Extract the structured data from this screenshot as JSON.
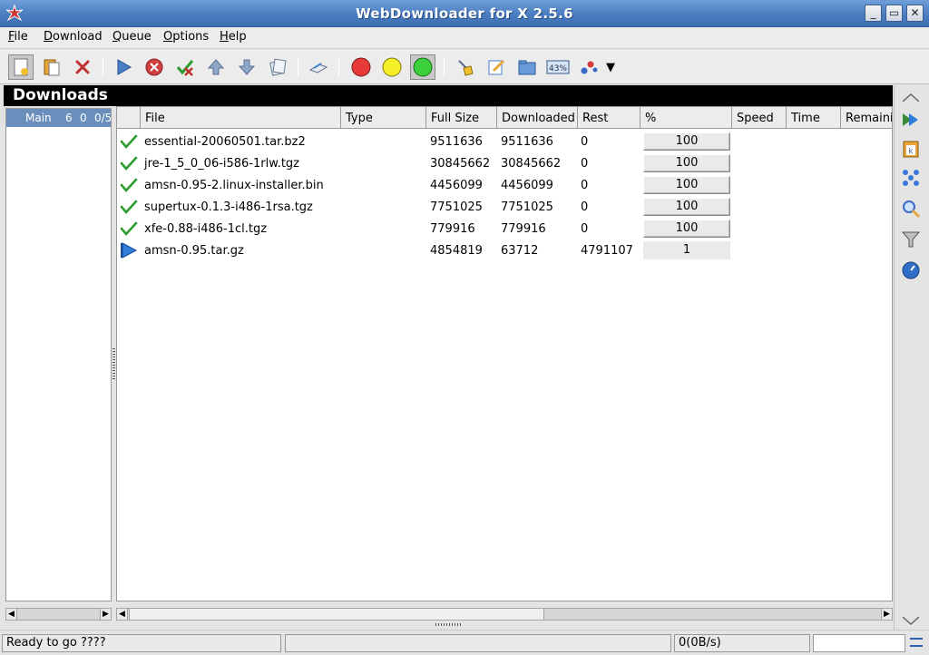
{
  "window": {
    "title": "WebDownloader for X 2.5.6",
    "controls": [
      "_",
      "▭",
      "✕"
    ]
  },
  "menu": [
    {
      "accel": "F",
      "rest": "ile"
    },
    {
      "accel": "D",
      "rest": "ownload"
    },
    {
      "accel": "Q",
      "rest": "ueue"
    },
    {
      "accel": "O",
      "rest": "ptions"
    },
    {
      "accel": "H",
      "rest": "elp"
    }
  ],
  "toolbar": {
    "icons": [
      "new-download-icon",
      "paste-icon",
      "delete-icon",
      "start-icon",
      "stop-icon",
      "delete-completed-icon",
      "move-up-icon",
      "move-down-icon",
      "log-icon",
      "properties-icon",
      "red-light-icon",
      "yellow-light-icon",
      "green-light-icon",
      "clear-icon",
      "edit-icon",
      "open-folder-icon",
      "speed-limit-icon",
      "graph-icon"
    ],
    "speed_limit_label": "43%",
    "dropdown_arrow": "▼"
  },
  "panel": {
    "title": "Downloads"
  },
  "tree": {
    "item": {
      "name": "Main",
      "total": "6",
      "running": "0",
      "completed": "0/5"
    }
  },
  "table": {
    "columns": [
      "",
      "File",
      "Type",
      "Full Size",
      "Downloaded",
      "Rest",
      "%",
      "Speed",
      "Time",
      "Remaini"
    ],
    "rows": [
      {
        "status": "complete",
        "file": "essential-20060501.tar.bz2",
        "type": "",
        "full_size": "9511636",
        "downloaded": "9511636",
        "rest": "0",
        "percent": "100",
        "progress": 100
      },
      {
        "status": "complete",
        "file": "jre-1_5_0_06-i586-1rlw.tgz",
        "type": "",
        "full_size": "30845662",
        "downloaded": "30845662",
        "rest": "0",
        "percent": "100",
        "progress": 100
      },
      {
        "status": "complete",
        "file": "amsn-0.95-2.linux-installer.bin",
        "type": "",
        "full_size": "4456099",
        "downloaded": "4456099",
        "rest": "0",
        "percent": "100",
        "progress": 100
      },
      {
        "status": "complete",
        "file": "supertux-0.1.3-i486-1rsa.tgz",
        "type": "",
        "full_size": "7751025",
        "downloaded": "7751025",
        "rest": "0",
        "percent": "100",
        "progress": 100
      },
      {
        "status": "complete",
        "file": "xfe-0.88-i486-1cl.tgz",
        "type": "",
        "full_size": "779916",
        "downloaded": "779916",
        "rest": "0",
        "percent": "100",
        "progress": 100
      },
      {
        "status": "paused",
        "file": "amsn-0.95.tar.gz",
        "type": "",
        "full_size": "4854819",
        "downloaded": "63712",
        "rest": "4791107",
        "percent": "1",
        "progress": 1
      }
    ]
  },
  "statusbar": {
    "message": "Ready to go ????",
    "speed": "0(0B/s)",
    "extra": ""
  },
  "colors": {
    "titlebar": "#4a7dc1",
    "selection": "#6b8fbd",
    "check": "#2e9e2e",
    "play": "#2f7fd8"
  }
}
